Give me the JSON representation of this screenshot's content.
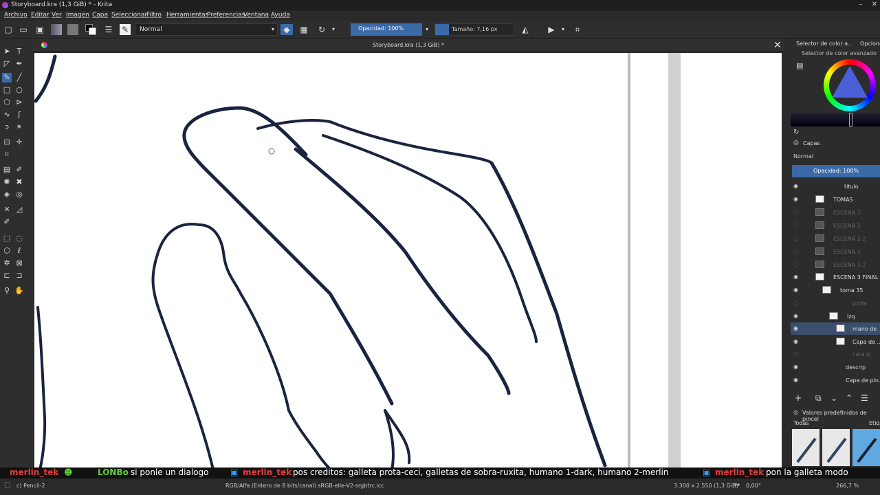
{
  "window": {
    "title": "Storyboard.kra (1,3 GiB) * - Krita",
    "min": "–",
    "close": "✕"
  },
  "menu": [
    "Archivo",
    "Editar",
    "Ver",
    "Imagen",
    "Capa",
    "Seleccionar",
    "Filtro",
    "Herramientas",
    "Preferencias",
    "Ventana",
    "Ayuda"
  ],
  "toolbar": {
    "blend_mode": "Normal",
    "opacity": "Opacidad: 100%",
    "size": "Tamaño: 7,16 px"
  },
  "document": {
    "tab_title": "Storyboard.kra (1,3 GiB) *",
    "close": "✕"
  },
  "panel": {
    "color_tab": "Selector de color a...",
    "options_tab": "Opcione",
    "color_subtitle": "Selector de color avanzado",
    "layers_title": "Capas",
    "layers_blend": "Normal",
    "layers_opacity": "Opacidad:  100%",
    "layers": [
      {
        "name": "titulo",
        "visible": true,
        "dim": false
      },
      {
        "name": "TOMAS",
        "visible": true,
        "dim": false
      },
      {
        "name": "ESCENA 1",
        "visible": false,
        "dim": true
      },
      {
        "name": "ESCENA 2",
        "visible": false,
        "dim": true
      },
      {
        "name": "ESCENA 2.2",
        "visible": false,
        "dim": true
      },
      {
        "name": "ESCENA 3",
        "visible": false,
        "dim": true
      },
      {
        "name": "ESCENA 3.2",
        "visible": false,
        "dim": true
      },
      {
        "name": "ESCENA 3 FINAL",
        "visible": true,
        "dim": false
      },
      {
        "name": "toma 35",
        "visible": true,
        "dim": false
      },
      {
        "name": "prota",
        "visible": false,
        "dim": true
      },
      {
        "name": "izq",
        "visible": true,
        "dim": false
      },
      {
        "name": "mano de",
        "visible": true,
        "dim": false,
        "selected": true
      },
      {
        "name": "Capa de ...",
        "visible": true,
        "dim": false
      },
      {
        "name": "cara iz",
        "visible": false,
        "dim": true
      },
      {
        "name": "descrip",
        "visible": true,
        "dim": false
      },
      {
        "name": "Capa de pin...",
        "visible": true,
        "dim": false
      }
    ],
    "presets_title": "Valores predefinidos de pincel",
    "presets_filter": "Todas",
    "presets_tag": "Etiqu"
  },
  "chat": [
    {
      "user": "merlin_tek",
      "color": "#e03c3c",
      "text": ""
    },
    {
      "user": "LONBo",
      "color": "#5bd23c",
      "text": "si ponle un dialogo"
    },
    {
      "user": "merlin_tek",
      "color": "#e03c3c",
      "text": "pos creditos: galleta prota-ceci, galletas de sobra-ruxita, humano 1-dark, humano 2-merlin"
    },
    {
      "user": "merlin_tek",
      "color": "#e03c3c",
      "text": "pon la galleta modo"
    }
  ],
  "status": {
    "tool": "c) Pencil-2",
    "colorspace": "RGB/Alfa (Entero de 8 bits/canal)  sRGB-elle-V2-srgbtrc.icc",
    "dimensions": "3.300 x 2.550 (1,3 GiB)",
    "rotation": "0,00°",
    "zoom": "266,7 %"
  },
  "colors": {
    "accent": "#3b6aa8",
    "ink": "#1a2340"
  }
}
